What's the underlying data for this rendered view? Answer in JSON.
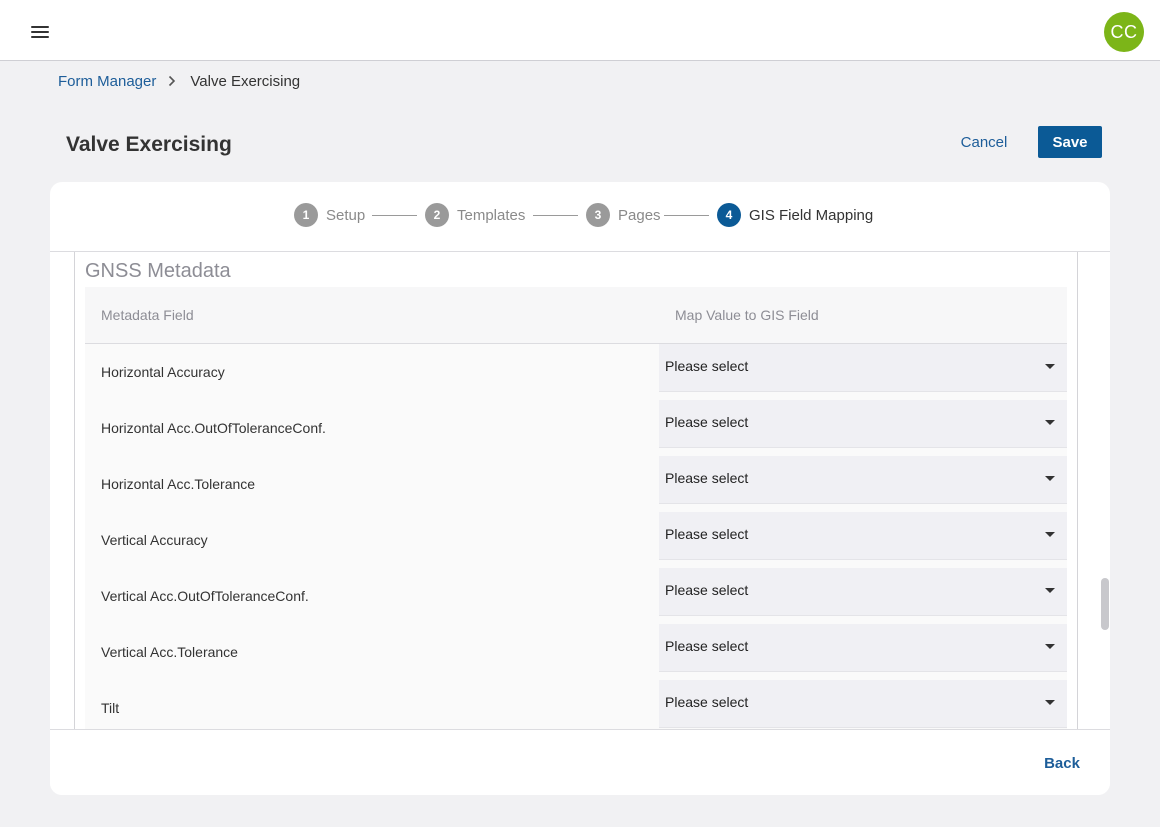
{
  "header": {
    "menu_icon": "hamburger-menu-icon",
    "avatar_initials": "CC",
    "avatar_color": "#7cb518"
  },
  "breadcrumb": {
    "parent": "Form Manager",
    "current": "Valve Exercising",
    "separator_icon": "chevron-right-icon"
  },
  "page": {
    "title": "Valve Exercising",
    "cancel_label": "Cancel",
    "save_label": "Save"
  },
  "stepper": {
    "steps": [
      {
        "number": "1",
        "label": "Setup",
        "active": false
      },
      {
        "number": "2",
        "label": "Templates",
        "active": false
      },
      {
        "number": "3",
        "label": "Pages",
        "active": false
      },
      {
        "number": "4",
        "label": "GIS Field Mapping",
        "active": true
      }
    ]
  },
  "section": {
    "title": "GNSS Metadata",
    "columns": {
      "field": "Metadata Field",
      "mapping": "Map Value to GIS Field"
    },
    "rows": [
      {
        "field": "Horizontal Accuracy",
        "value": "Please select"
      },
      {
        "field": "Horizontal Acc.OutOfToleranceConf.",
        "value": "Please select"
      },
      {
        "field": "Horizontal Acc.Tolerance",
        "value": "Please select"
      },
      {
        "field": "Vertical Accuracy",
        "value": "Please select"
      },
      {
        "field": "Vertical Acc.OutOfToleranceConf.",
        "value": "Please select"
      },
      {
        "field": "Vertical Acc.Tolerance",
        "value": "Please select"
      },
      {
        "field": "Tilt",
        "value": "Please select"
      }
    ]
  },
  "footer": {
    "back_label": "Back"
  },
  "colors": {
    "primary": "#0b5a96",
    "link": "#1d5d99",
    "step_inactive": "#9a9a9a"
  }
}
